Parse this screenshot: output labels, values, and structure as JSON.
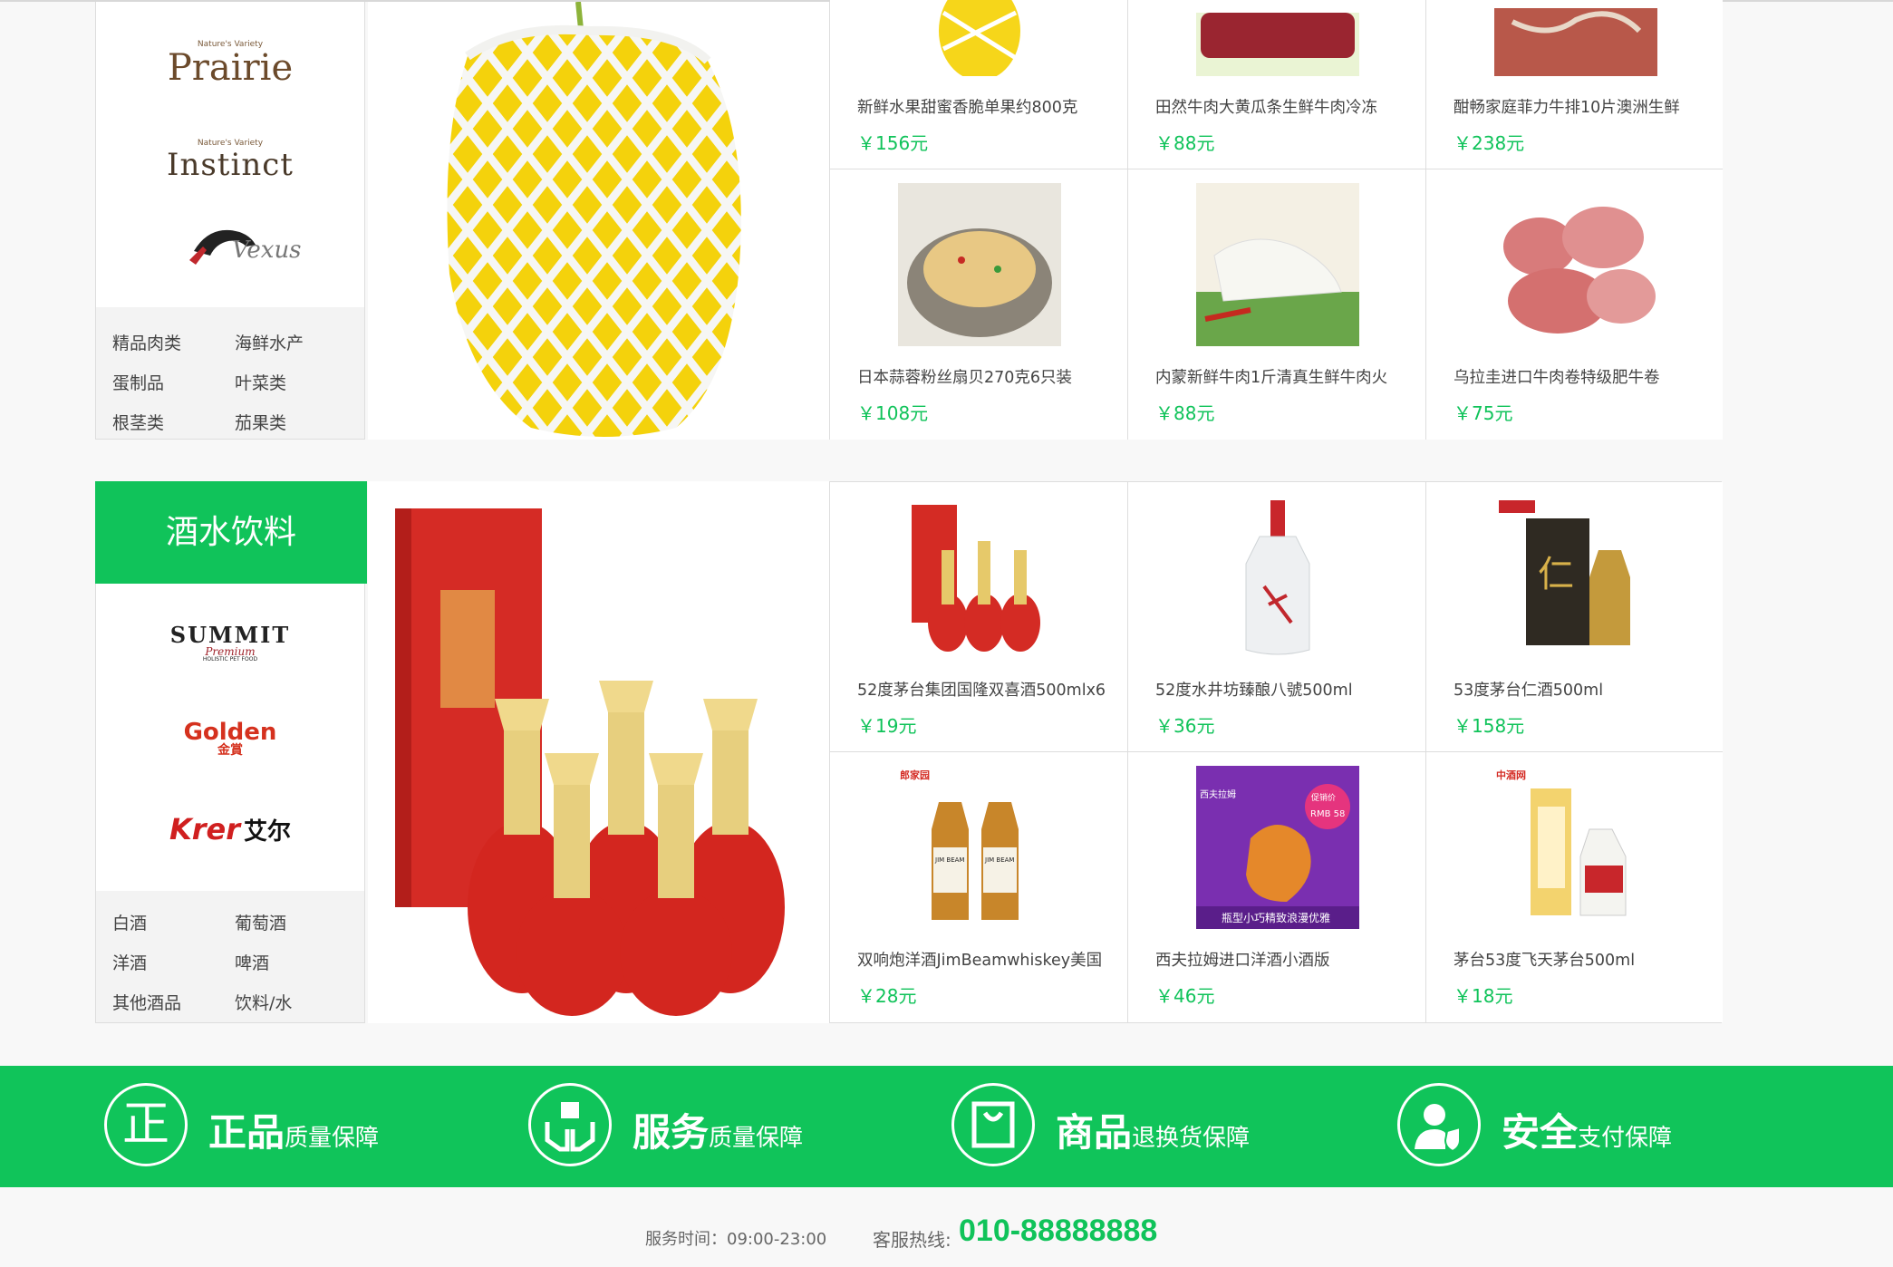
{
  "section_fresh": {
    "brands": [
      "Nature's Variety",
      "Prairie",
      "Nature's Variety",
      "Instinct",
      "Vexus"
    ],
    "categories": [
      "精品肉类",
      "海鲜水产",
      "蛋制品",
      "叶菜类",
      "根茎类",
      "茄果类"
    ],
    "products": [
      {
        "name": "新鲜水果甜蜜香脆单果约800克",
        "price": "￥156元",
        "image": "pear-in-net"
      },
      {
        "name": "田然牛肉大黄瓜条生鲜牛肉冷冻",
        "price": "￥88元",
        "image": "raw-beef"
      },
      {
        "name": "酣畅家庭菲力牛排10片澳洲生鲜",
        "price": "￥238元",
        "image": "grilled-steak"
      },
      {
        "name": "日本蒜蓉粉丝扇贝270克6只装",
        "price": "￥108元",
        "image": "garlic-scallop"
      },
      {
        "name": "内蒙新鲜牛肉1斤清真生鲜牛肉火",
        "price": "￥88元",
        "image": "tripe-with-scallion"
      },
      {
        "name": "乌拉圭进口牛肉卷特级肥牛卷",
        "price": "￥75元",
        "image": "beef-rolls"
      }
    ]
  },
  "section_drinks": {
    "title": "酒水饮料",
    "brands": [
      "SUMMIT",
      "Premium",
      "HOLISTIC PET FOOD",
      "Golden",
      "金賞",
      "Krer",
      "艾尔"
    ],
    "categories": [
      "白酒",
      "葡萄酒",
      "洋酒",
      "啤酒",
      "其他酒品",
      "饮料/水"
    ],
    "products": [
      {
        "name": "52度茅台集团国隆双喜酒500mlx6",
        "price": "￥19元",
        "image": "red-baijiu-set"
      },
      {
        "name": "52度水井坊臻酿八號500ml",
        "price": "￥36元",
        "image": "shuijingfang-bottle"
      },
      {
        "name": "53度茅台仁酒500ml",
        "price": "￥158元",
        "image": "ren-jiu-box"
      },
      {
        "name": "双响炮洋酒JimBeamwhiskey美国",
        "price": "￥28元",
        "image": "jim-beam-pair",
        "tag": "郎家园",
        "label": "JIM BEAM"
      },
      {
        "name": "西夫拉姆进口洋酒小酒版",
        "price": "￥46元",
        "image": "cognac-promo",
        "promo": "促销价",
        "promo_price": "RMB 58",
        "promo_line": "瓶型小巧精致浪漫优雅",
        "promo_brand": "西夫拉姆"
      },
      {
        "name": "茅台53度飞天茅台500ml",
        "price": "￥18元",
        "image": "moutai-box",
        "tag": "中酒网"
      }
    ]
  },
  "guarantees": [
    {
      "big": "正品",
      "small": "质量保障",
      "icon": "zheng-icon"
    },
    {
      "big": "服务",
      "small": "质量保障",
      "icon": "hands-gift-icon"
    },
    {
      "big": "商品",
      "small": "退换货保障",
      "icon": "bag-icon"
    },
    {
      "big": "安全",
      "small": "支付保障",
      "icon": "shield-user-icon"
    }
  ],
  "footer": {
    "hours": "服务时间：09:00-23:00",
    "hotline_label": "客服热线:",
    "hotline": "010-88888888"
  },
  "colors": {
    "accent": "#10c35a",
    "price": "#10c35a"
  }
}
